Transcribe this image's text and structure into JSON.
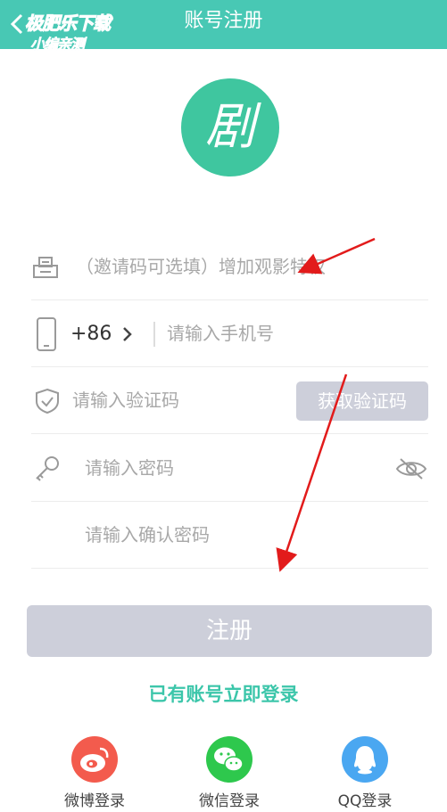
{
  "header": {
    "title": "账号注册",
    "watermark_line1": "极肥乐下载",
    "watermark_line2": "小编亲测"
  },
  "logo": {
    "glyph": "剧",
    "color": "#3fc69f"
  },
  "form": {
    "invite": {
      "placeholder": "（邀请码可选填）增加观影特权"
    },
    "phone": {
      "country_code": "+86",
      "placeholder": "请输入手机号"
    },
    "code": {
      "placeholder": "请输入验证码",
      "button": "获取验证码"
    },
    "password": {
      "placeholder": "请输入密码"
    },
    "confirm": {
      "placeholder": "请输入确认密码"
    }
  },
  "actions": {
    "register": "注册",
    "login_link": "已有账号立即登录"
  },
  "social": [
    {
      "label": "微博登录",
      "icon": "weibo-icon",
      "color": "#f35b4d"
    },
    {
      "label": "微信登录",
      "icon": "wechat-icon",
      "color": "#2ec84d"
    },
    {
      "label": "QQ登录",
      "icon": "qq-icon",
      "color": "#4aa7f1"
    }
  ],
  "colors": {
    "accent": "#48c8b4",
    "disabled": "#cdcfda",
    "arrow": "#e21b1b"
  }
}
